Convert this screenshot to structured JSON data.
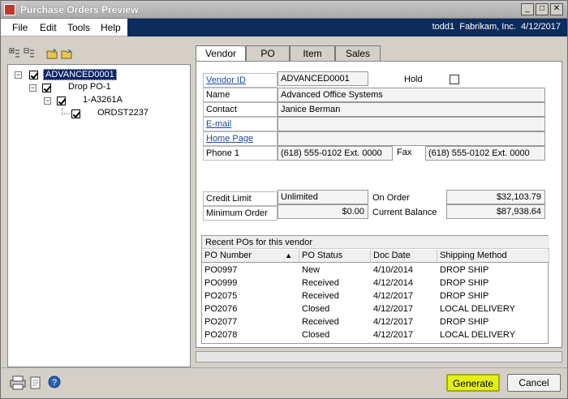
{
  "window": {
    "title": "Purchase Orders Preview"
  },
  "menu": [
    {
      "label": "File"
    },
    {
      "label": "Edit"
    },
    {
      "label": "Tools"
    },
    {
      "label": "Help"
    }
  ],
  "session": {
    "text": "todd1  Fabrikam, Inc.  4/12/2017"
  },
  "tree": {
    "nodes": [
      {
        "label": "ADVANCED0001"
      },
      {
        "label": "Drop PO-1"
      },
      {
        "label": "1-A3261A"
      },
      {
        "label": "ORDST2237"
      }
    ]
  },
  "tabs": [
    {
      "label": "Vendor"
    },
    {
      "label": "PO"
    },
    {
      "label": "Item"
    },
    {
      "label": "Sales"
    }
  ],
  "vendor": {
    "vendor_id_label": "Vendor ID",
    "vendor_id": "ADVANCED0001",
    "hold_label": "Hold",
    "name_label": "Name",
    "name": "Advanced Office Systems",
    "contact_label": "Contact",
    "contact": "Janice Berman",
    "email_label": "E-mail",
    "homepage_label": "Home Page",
    "phone1_label": "Phone 1",
    "phone1": "(618) 555-0102  Ext. 0000",
    "fax_label": "Fax",
    "fax": "(618) 555-0102  Ext. 0000",
    "credit_limit_label": "Credit Limit",
    "credit_limit": "Unlimited",
    "on_order_label": "On Order",
    "on_order": "$32,103.79",
    "min_order_label": "Minimum Order",
    "min_order": "$0.00",
    "balance_label": "Current Balance",
    "balance": "$87,938.64"
  },
  "recent": {
    "title": "Recent POs for this vendor",
    "headers": [
      "PO Number",
      "PO Status",
      "Doc Date",
      "Shipping Method"
    ],
    "rows": [
      [
        "PO0997",
        "New",
        "4/10/2014",
        "DROP SHIP"
      ],
      [
        "PO0999",
        "Received",
        "4/12/2014",
        "DROP SHIP"
      ],
      [
        "PO2075",
        "Received",
        "4/12/2017",
        "DROP SHIP"
      ],
      [
        "PO2076",
        "Closed",
        "4/12/2017",
        "LOCAL DELIVERY"
      ],
      [
        "PO2077",
        "Received",
        "4/12/2017",
        "DROP SHIP"
      ],
      [
        "PO2078",
        "Closed",
        "4/12/2017",
        "LOCAL DELIVERY"
      ]
    ]
  },
  "buttons": {
    "generate": "Generate",
    "cancel": "Cancel"
  },
  "icons": [
    "expand-all-icon",
    "collapse-all-icon",
    "new-folder-icon",
    "open-folder-icon",
    "printer-icon",
    "help-icon"
  ]
}
